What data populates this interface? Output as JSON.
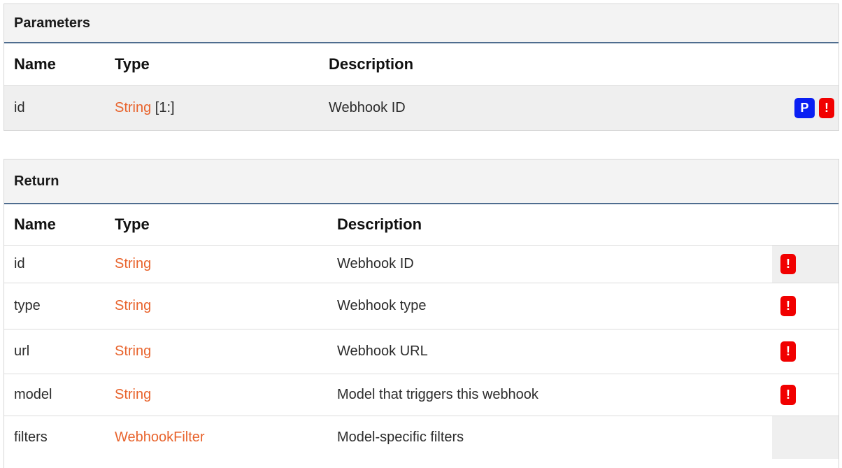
{
  "parameters": {
    "title": "Parameters",
    "headers": {
      "name": "Name",
      "type": "Type",
      "description": "Description"
    },
    "rows": [
      {
        "name": "id",
        "type": "String",
        "type_suffix": " [1:]",
        "description": "Webhook ID",
        "badges": [
          "P",
          "!"
        ]
      }
    ]
  },
  "return": {
    "title": "Return",
    "headers": {
      "name": "Name",
      "type": "Type",
      "description": "Description"
    },
    "rows": [
      {
        "name": "id",
        "type": "String",
        "description": "Webhook ID",
        "required": "!"
      },
      {
        "name": "type",
        "type": "String",
        "description": "Webhook type",
        "required": "!"
      },
      {
        "name": "url",
        "type": "String",
        "description": "Webhook URL",
        "required": "!"
      },
      {
        "name": "model",
        "type": "String",
        "description": "Model that triggers this webhook",
        "required": "!"
      },
      {
        "name": "filters",
        "type": "WebhookFilter",
        "description": "Model-specific filters",
        "required": ""
      }
    ]
  },
  "colors": {
    "link": "#e8632c",
    "badge_p": "#0a1ff3",
    "badge_required": "#f10000",
    "header_rule": "#4f6d8f"
  }
}
